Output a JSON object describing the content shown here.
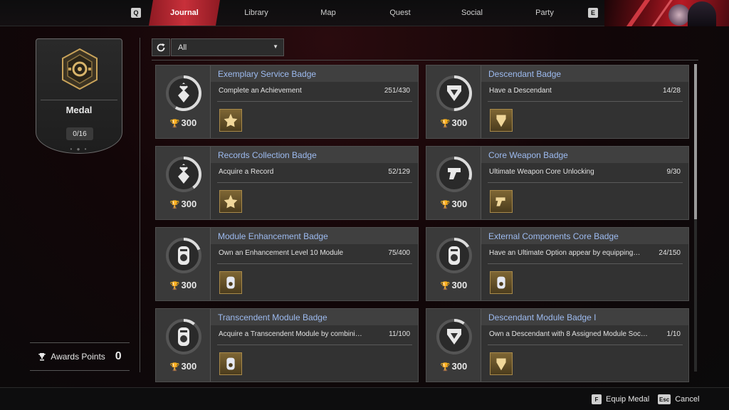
{
  "nav": {
    "left_key": "Q",
    "right_key": "E",
    "tabs": [
      {
        "label": "Journal",
        "active": true
      },
      {
        "label": "Library"
      },
      {
        "label": "Map"
      },
      {
        "label": "Quest"
      },
      {
        "label": "Social"
      },
      {
        "label": "Party"
      }
    ]
  },
  "medal": {
    "title": "Medal",
    "count": "0/16",
    "icon": "medal-hexagon-icon"
  },
  "awards": {
    "label": "Awards Points",
    "value": "0",
    "icon": "trophy-icon"
  },
  "filter": {
    "selected": "All",
    "refresh_icon": "refresh-icon"
  },
  "cards": [
    {
      "title": "Exemplary Service Badge",
      "desc": "Complete an Achievement",
      "progress": "251/430",
      "points": "300",
      "fill": 0.58,
      "icon": "service-badge-icon",
      "reward": "gold-star-reward"
    },
    {
      "title": "Descendant Badge",
      "desc": "Have a Descendant",
      "progress": "14/28",
      "points": "300",
      "fill": 0.5,
      "icon": "descendant-badge-icon",
      "reward": "gold-descendant-reward"
    },
    {
      "title": "Records Collection Badge",
      "desc": "Acquire a Record",
      "progress": "52/129",
      "points": "300",
      "fill": 0.4,
      "icon": "records-badge-icon",
      "reward": "gold-star-reward"
    },
    {
      "title": "Core Weapon Badge",
      "desc": "Ultimate Weapon Core Unlocking",
      "progress": "9/30",
      "points": "300",
      "fill": 0.3,
      "icon": "weapon-badge-icon",
      "reward": "gold-weapon-reward"
    },
    {
      "title": "Module Enhancement Badge",
      "desc": "Own an Enhancement Level 10 Module",
      "progress": "75/400",
      "points": "300",
      "fill": 0.19,
      "icon": "module-badge-icon",
      "reward": "gold-module-reward"
    },
    {
      "title": "External Components Core Badge",
      "desc": "Have an Ultimate Option appear by equipping…",
      "progress": "24/150",
      "points": "300",
      "fill": 0.16,
      "icon": "module-badge-icon",
      "reward": "gold-module-reward"
    },
    {
      "title": "Transcendent Module Badge",
      "desc": "Acquire a Transcendent Module by combini…",
      "progress": "11/100",
      "points": "300",
      "fill": 0.11,
      "icon": "module-badge-icon",
      "reward": "gold-module-reward"
    },
    {
      "title": "Descendant Module Badge I",
      "desc": "Own a Descendant with 8 Assigned Module Soc…",
      "progress": "1/10",
      "points": "300",
      "fill": 0.1,
      "icon": "descendant-badge-icon",
      "reward": "gold-descendant-reward"
    }
  ],
  "footer": {
    "equip_key": "F",
    "equip_label": "Equip Medal",
    "cancel_key": "Esc",
    "cancel_label": "Cancel"
  },
  "colors": {
    "accent_red": "#c8303a",
    "title_blue": "#9dbbf0",
    "gold": "#a98a4a"
  }
}
